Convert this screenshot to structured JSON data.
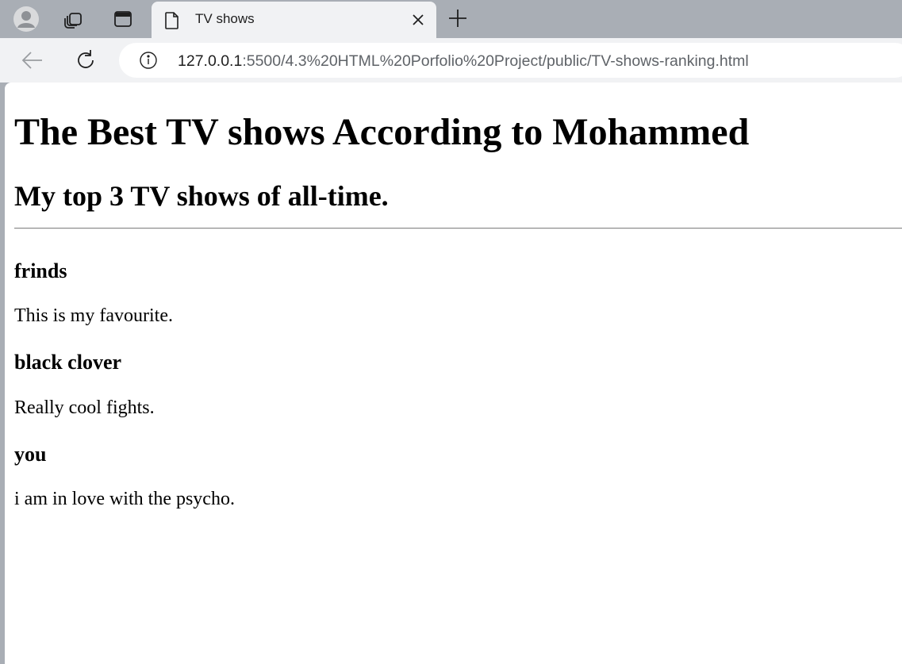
{
  "browser": {
    "tab": {
      "title": "TV shows"
    },
    "address_bar": {
      "host": "127.0.0.1",
      "path": ":5500/4.3%20HTML%20Porfolio%20Project/public/TV-shows-ranking.html"
    },
    "icons": [
      "profile-icon",
      "workspaces-icon",
      "tab-actions-icon",
      "page-icon",
      "close-icon",
      "plus-icon",
      "back-arrow-icon",
      "reload-icon",
      "info-icon"
    ]
  },
  "page": {
    "heading": "The Best TV shows According to Mohammed",
    "subheading": "My top 3 TV shows of all-time.",
    "shows": [
      {
        "title": "frinds",
        "description": "This is my favourite."
      },
      {
        "title": "black clover",
        "description": "Really cool fights."
      },
      {
        "title": "you",
        "description": "i am in love with the psycho."
      }
    ]
  }
}
